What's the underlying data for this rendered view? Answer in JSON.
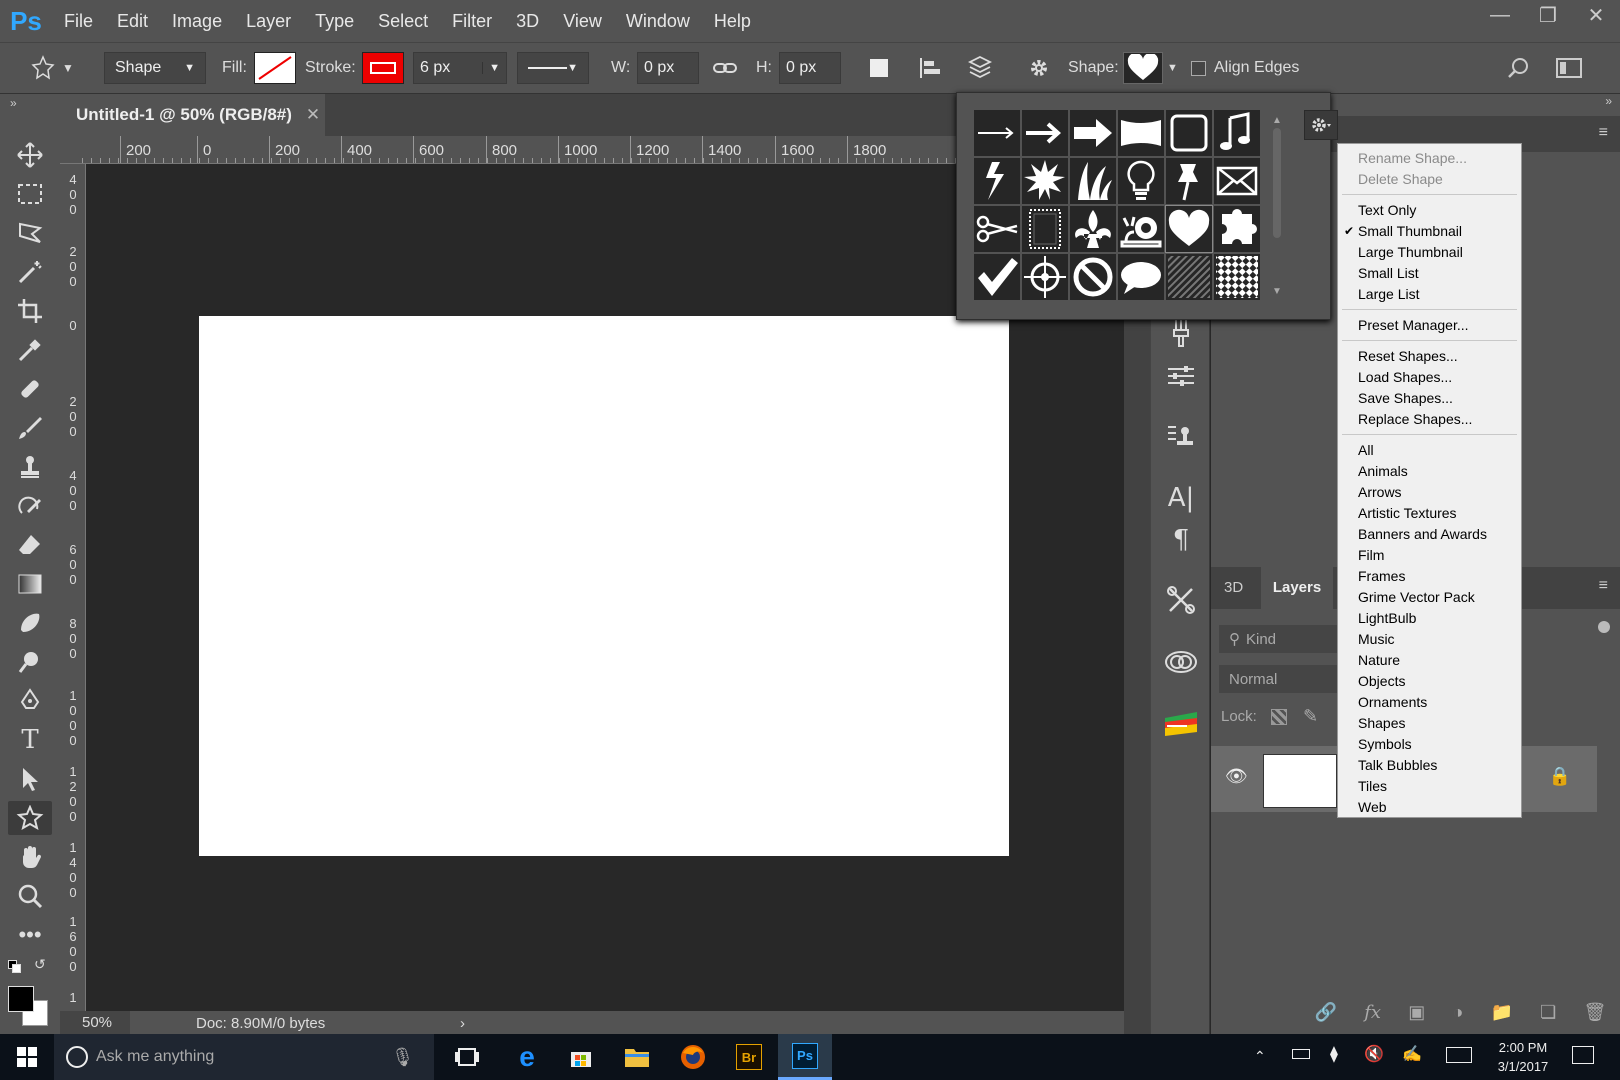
{
  "app": {
    "logo": "Ps",
    "menus": [
      "File",
      "Edit",
      "Image",
      "Layer",
      "Type",
      "Select",
      "Filter",
      "3D",
      "View",
      "Window",
      "Help"
    ]
  },
  "options": {
    "mode": "Shape",
    "fill_label": "Fill:",
    "stroke_label": "Stroke:",
    "stroke_width": "6 px",
    "w_label": "W:",
    "w_value": "0 px",
    "h_label": "H:",
    "h_value": "0 px",
    "shape_label": "Shape:",
    "align_edges": "Align Edges",
    "stroke_color": "#ff0000"
  },
  "document": {
    "tab_title": "Untitled-1 @ 50% (RGB/8#)",
    "zoom": "50%",
    "doc_info": "Doc: 8.90M/0 bytes"
  },
  "ruler": {
    "h": [
      "200",
      "0",
      "200",
      "400",
      "600",
      "800",
      "1000",
      "1200",
      "1400",
      "1600",
      "1800"
    ],
    "v": [
      "4\n0\n0",
      "2\n0\n0",
      "0",
      "2\n0\n0",
      "4\n0\n0",
      "6\n0\n0",
      "8\n0\n0",
      "1\n0\n0\n0",
      "1\n2\n0\n0",
      "1\n4\n0\n0",
      "1\n6\n0\n0",
      "1"
    ]
  },
  "shapes": [
    "arrow-thin-icon",
    "arrow-medium-icon",
    "arrow-bold-icon",
    "banner-icon",
    "frame-icon",
    "music-note-icon",
    "lightning-icon",
    "starburst-icon",
    "grass-icon",
    "lightbulb-icon",
    "pushpin-icon",
    "envelope-icon",
    "scissors-icon",
    "film-frame-icon",
    "fleur-de-lis-icon",
    "snail-icon",
    "heart-icon",
    "puzzle-icon",
    "checkmark-icon",
    "target-icon",
    "no-sign-icon",
    "talk-bubble-icon",
    "grid-pattern-icon",
    "checker-pattern-icon"
  ],
  "menu": {
    "group1": [
      "Rename Shape...",
      "Delete Shape"
    ],
    "group2": [
      "Text Only",
      "Small Thumbnail",
      "Large Thumbnail",
      "Small List",
      "Large List"
    ],
    "checked": "Small Thumbnail",
    "group3": [
      "Preset Manager..."
    ],
    "group4": [
      "Reset Shapes...",
      "Load Shapes...",
      "Save Shapes...",
      "Replace Shapes..."
    ],
    "group5": [
      "All",
      "Animals",
      "Arrows",
      "Artistic Textures",
      "Banners and Awards",
      "Film",
      "Frames",
      "Grime Vector Pack",
      "LightBulb",
      "Music",
      "Nature",
      "Objects",
      "Ornaments",
      "Shapes",
      "Symbols",
      "Talk Bubbles",
      "Tiles",
      "Web"
    ]
  },
  "layers": {
    "tab_3d": "3D",
    "tab_layers": "Layers",
    "kind_placeholder": "Kind",
    "blend_mode": "Normal",
    "lock_label": "Lock:"
  },
  "taskbar": {
    "search_placeholder": "Ask me anything",
    "time": "2:00 PM",
    "date": "3/1/2017"
  },
  "colors": {
    "ps_blue": "#31a8ff",
    "panel": "#535353",
    "canvas": "#282828"
  }
}
